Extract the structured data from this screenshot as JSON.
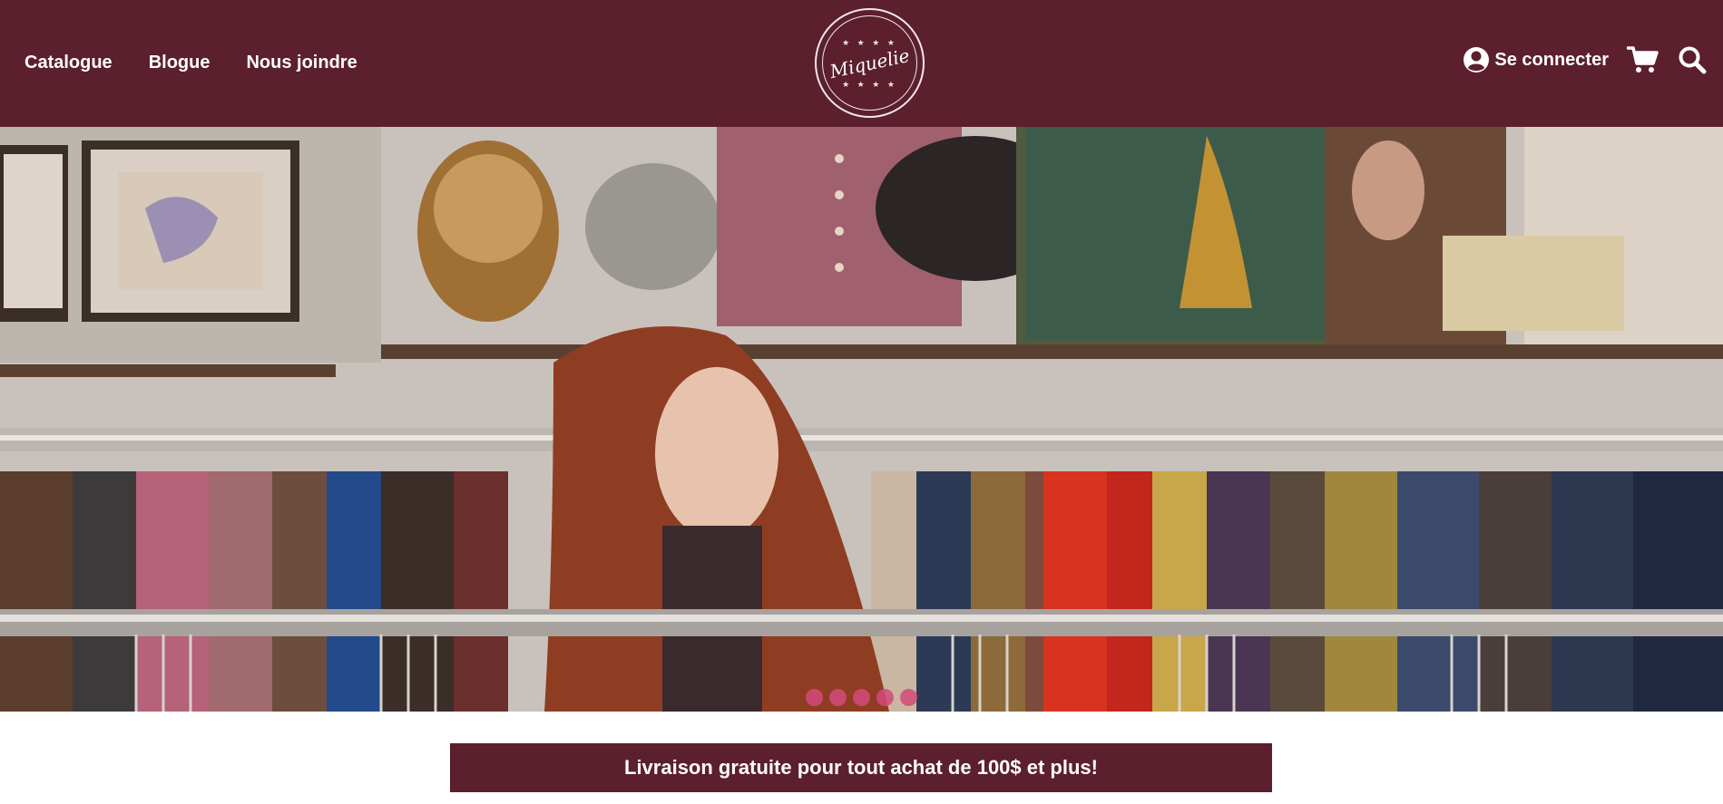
{
  "nav": {
    "items": [
      {
        "label": "Catalogue"
      },
      {
        "label": "Blogue"
      },
      {
        "label": "Nous joindre"
      }
    ]
  },
  "logo": {
    "text": "Miquelie",
    "stars_top": "★ ★ ★ ★",
    "stars_bottom": "★ ★ ★ ★"
  },
  "account": {
    "login_label": "Se connecter",
    "user_icon": "user-circle-icon",
    "cart_icon": "cart-icon",
    "search_icon": "search-icon"
  },
  "hero": {
    "image_subject": "thrift-store-photo",
    "slide_count": 5,
    "active_slide": 1
  },
  "banner": {
    "text": "Livraison gratuite pour tout achat de 100$ et plus!"
  },
  "colors": {
    "brand": "#5c1f2e",
    "dot": "#d34a7a",
    "text_light": "#ffffff"
  }
}
